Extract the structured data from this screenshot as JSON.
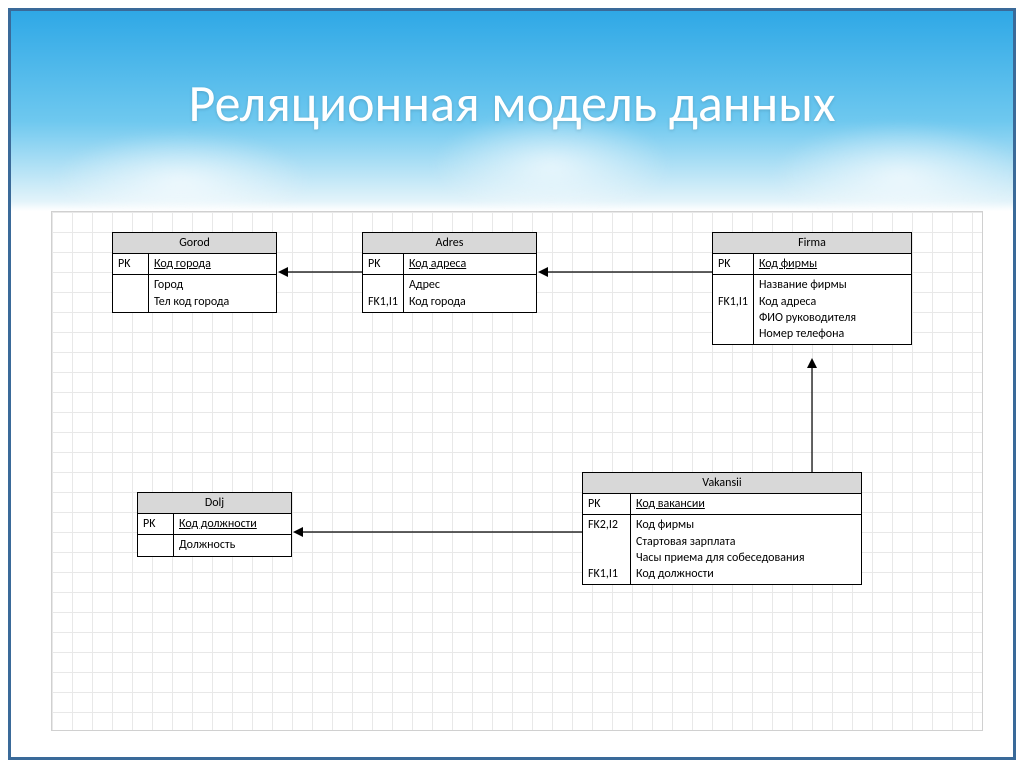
{
  "title": "Реляционная модель данных",
  "entities": {
    "gorod": {
      "name": "Gorod",
      "pk_key": "PK",
      "pk_attr": "Код города",
      "attrs_keys": "",
      "attrs": [
        "Город",
        "Тел код города"
      ]
    },
    "adres": {
      "name": "Adres",
      "pk_key": "PK",
      "pk_attr": "Код адреса",
      "sec2_keys": [
        "",
        "FK1,I1"
      ],
      "sec2_attrs": [
        "Адрес",
        "Код города"
      ]
    },
    "firma": {
      "name": "Firma",
      "pk_key": "PK",
      "pk_attr": "Код фирмы",
      "sec2_keys": [
        "",
        "FK1,I1",
        "",
        ""
      ],
      "sec2_attrs": [
        "Название фирмы",
        "Код адреса",
        "ФИО руководителя",
        "Номер телефона"
      ]
    },
    "dolj": {
      "name": "Dolj",
      "pk_key": "PK",
      "pk_attr": "Код должности",
      "attrs_keys": "",
      "attrs": [
        "Должность"
      ]
    },
    "vakansii": {
      "name": "Vakansii",
      "pk_key": "PK",
      "pk_attr": "Код вакансии",
      "sec2_keys": [
        "FK2,I2",
        "",
        "",
        "FK1,I1"
      ],
      "sec2_attrs": [
        "Код фирмы",
        "Стартовая зарплата",
        "Часы приема для собеседования",
        "Код должности"
      ]
    }
  }
}
